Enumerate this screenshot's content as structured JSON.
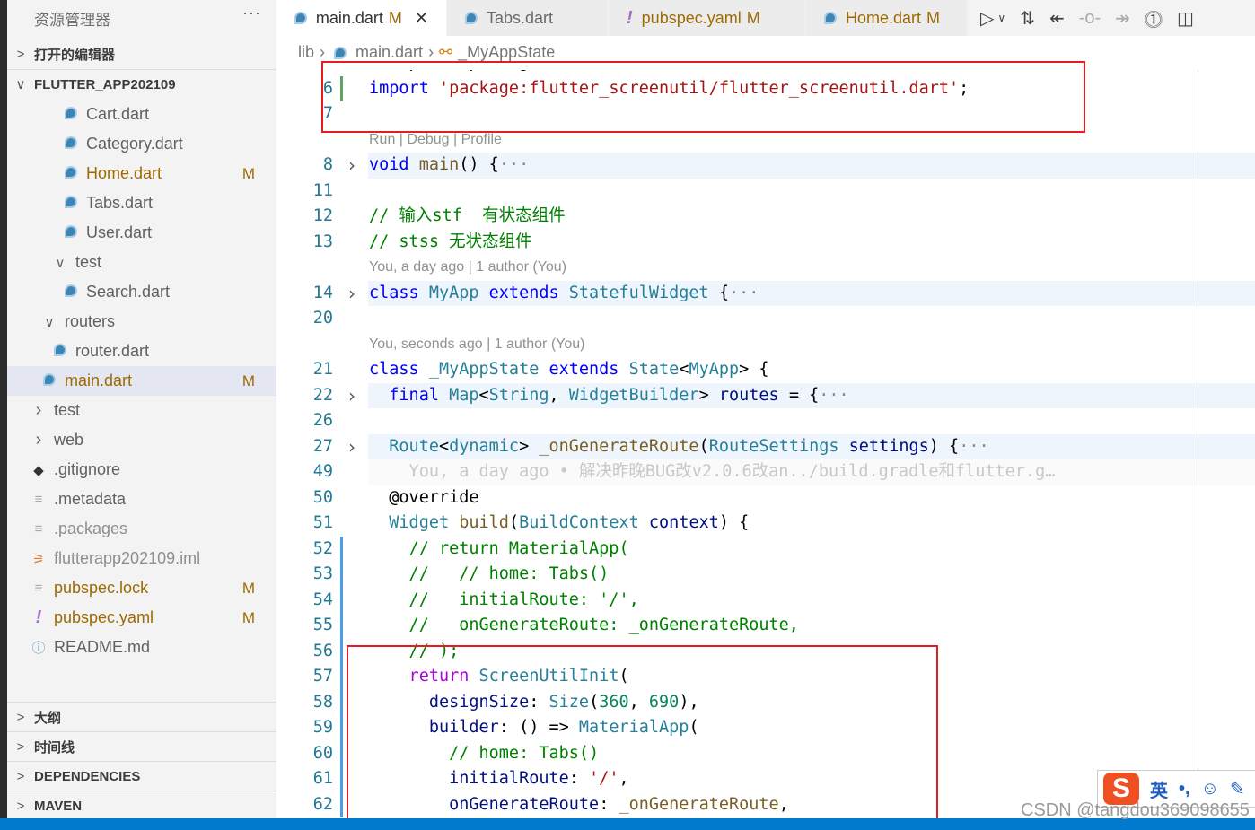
{
  "sidebar": {
    "title": "资源管理器",
    "more": "···",
    "open_editors": "打开的编辑器",
    "project": "FLUTTER_APP202109",
    "items": [
      {
        "label": "Cart.dart",
        "icon": "dart-icon",
        "indent": 60
      },
      {
        "label": "Category.dart",
        "icon": "dart-icon",
        "indent": 60
      },
      {
        "label": "Home.dart",
        "icon": "dart-icon",
        "indent": 60,
        "badge": "M"
      },
      {
        "label": "Tabs.dart",
        "icon": "dart-icon",
        "indent": 60
      },
      {
        "label": "User.dart",
        "icon": "dart-icon",
        "indent": 60
      },
      {
        "label": "test",
        "icon": "chevron-down-icon",
        "indent": 48
      },
      {
        "label": "Search.dart",
        "icon": "dart-icon",
        "indent": 60
      },
      {
        "label": "routers",
        "icon": "chevron-down-icon",
        "indent": 36
      },
      {
        "label": "router.dart",
        "icon": "dart-icon",
        "indent": 48
      },
      {
        "label": "main.dart",
        "icon": "dart-icon",
        "indent": 36,
        "badge": "M",
        "selected": true
      },
      {
        "label": "test",
        "icon": "chevron-right-icon",
        "indent": 24
      },
      {
        "label": "web",
        "icon": "chevron-right-icon",
        "indent": 24
      },
      {
        "label": ".gitignore",
        "icon": "git-icon",
        "indent": 24
      },
      {
        "label": ".metadata",
        "icon": "file-lines-icon",
        "indent": 24
      },
      {
        "label": ".packages",
        "icon": "file-lines-icon",
        "indent": 24,
        "dim": true
      },
      {
        "label": "flutterapp202109.iml",
        "icon": "rss-icon",
        "indent": 24,
        "dim": true
      },
      {
        "label": "pubspec.lock",
        "icon": "file-lines-icon",
        "indent": 24,
        "badge": "M"
      },
      {
        "label": "pubspec.yaml",
        "icon": "exclamation-icon",
        "indent": 24,
        "badge": "M"
      },
      {
        "label": "README.md",
        "icon": "info-icon",
        "indent": 24
      }
    ],
    "panels": [
      "大纲",
      "时间线",
      "DEPENDENCIES",
      "MAVEN"
    ]
  },
  "tabs": [
    {
      "label": "main.dart",
      "badge": "M",
      "active": true,
      "icon": "dart-icon"
    },
    {
      "label": "Tabs.dart",
      "icon": "dart-icon"
    },
    {
      "label": "pubspec.yaml",
      "badge": "M",
      "icon": "exclamation-icon"
    },
    {
      "label": "Home.dart",
      "badge": "M",
      "icon": "dart-icon"
    }
  ],
  "breadcrumb": [
    "lib",
    "main.dart",
    "_MyAppState"
  ],
  "code": [
    {
      "ln": "",
      "seg": [
        [
          "  import 'package:.../...';",
          "p"
        ]
      ]
    },
    {
      "ln": "6",
      "gutter": "#5ca463",
      "seg": [
        [
          "import ",
          "k"
        ],
        [
          "'package:flutter_screenutil/flutter_screenutil.dart'",
          "s"
        ],
        [
          ";",
          "p"
        ]
      ]
    },
    {
      "ln": "7",
      "seg": []
    },
    {
      "lens": "Run | Debug | Profile"
    },
    {
      "ln": "8",
      "fold": true,
      "hl": true,
      "seg": [
        [
          "void ",
          "k"
        ],
        [
          "main",
          "f"
        ],
        [
          "() {",
          "p"
        ],
        [
          "···",
          "dot"
        ]
      ]
    },
    {
      "ln": "11",
      "seg": []
    },
    {
      "ln": "12",
      "seg": [
        [
          "// 输入stf  有状态组件",
          "c"
        ]
      ]
    },
    {
      "ln": "13",
      "seg": [
        [
          "// stss 无状态组件",
          "c"
        ]
      ]
    },
    {
      "lens": "You, a day ago | 1 author (You)"
    },
    {
      "ln": "14",
      "fold": true,
      "hl": true,
      "seg": [
        [
          "class ",
          "k"
        ],
        [
          "MyApp ",
          "t"
        ],
        [
          "extends ",
          "k"
        ],
        [
          "StatefulWidget ",
          "t"
        ],
        [
          "{",
          "p"
        ],
        [
          "···",
          "dot"
        ]
      ]
    },
    {
      "ln": "20",
      "seg": []
    },
    {
      "lens": "You, seconds ago | 1 author (You)"
    },
    {
      "ln": "21",
      "seg": [
        [
          "class ",
          "k"
        ],
        [
          "_MyAppState ",
          "t"
        ],
        [
          "extends ",
          "k"
        ],
        [
          "State",
          "t"
        ],
        [
          "<",
          "p"
        ],
        [
          "MyApp",
          "t"
        ],
        [
          "> {",
          "p"
        ]
      ]
    },
    {
      "ln": "22",
      "fold": true,
      "hl": true,
      "seg": [
        [
          "  final ",
          "k"
        ],
        [
          "Map",
          "t"
        ],
        [
          "<",
          "p"
        ],
        [
          "String",
          "t"
        ],
        [
          ", ",
          "p"
        ],
        [
          "WidgetBuilder",
          "t"
        ],
        [
          "> ",
          "p"
        ],
        [
          "routes",
          "v"
        ],
        [
          " = {",
          "p"
        ],
        [
          "···",
          "dot"
        ]
      ]
    },
    {
      "ln": "26",
      "seg": []
    },
    {
      "ln": "27",
      "fold": true,
      "hl": true,
      "seg": [
        [
          "  Route",
          "t"
        ],
        [
          "<",
          "p"
        ],
        [
          "dynamic",
          "t"
        ],
        [
          "> ",
          "p"
        ],
        [
          "_onGenerateRoute",
          "f"
        ],
        [
          "(",
          "p"
        ],
        [
          "RouteSettings ",
          "t"
        ],
        [
          "settings",
          "v"
        ],
        [
          ") {",
          "p"
        ],
        [
          "···",
          "dot"
        ]
      ]
    },
    {
      "ln": "49",
      "blame": true,
      "seg": [
        [
          "    You, a day ago • 解决昨晚BUG改v2.0.6改an../build.gradle和flutter.g…",
          ""
        ]
      ]
    },
    {
      "ln": "50",
      "seg": [
        [
          "  @override",
          "p"
        ]
      ]
    },
    {
      "ln": "51",
      "seg": [
        [
          "  Widget ",
          "t"
        ],
        [
          "build",
          "f"
        ],
        [
          "(",
          "p"
        ],
        [
          "BuildContext ",
          "t"
        ],
        [
          "context",
          "v"
        ],
        [
          ") {",
          "p"
        ]
      ]
    },
    {
      "ln": "52",
      "gutter": "#4d9ee8",
      "seg": [
        [
          "    // return MaterialApp(",
          "c"
        ]
      ]
    },
    {
      "ln": "53",
      "gutter": "#4d9ee8",
      "seg": [
        [
          "    //   // home: Tabs()",
          "c"
        ]
      ]
    },
    {
      "ln": "54",
      "gutter": "#4d9ee8",
      "seg": [
        [
          "    //   initialRoute: '/',",
          "c"
        ]
      ]
    },
    {
      "ln": "55",
      "gutter": "#4d9ee8",
      "seg": [
        [
          "    //   onGenerateRoute: _onGenerateRoute,",
          "c"
        ]
      ]
    },
    {
      "ln": "56",
      "gutter": "#4d9ee8",
      "seg": [
        [
          "    // );",
          "c"
        ]
      ]
    },
    {
      "ln": "57",
      "gutter": "#4d9ee8",
      "seg": [
        [
          "    return ",
          "r"
        ],
        [
          "ScreenUtilInit",
          "t"
        ],
        [
          "(",
          "p"
        ]
      ]
    },
    {
      "ln": "58",
      "gutter": "#4d9ee8",
      "seg": [
        [
          "      designSize",
          "v"
        ],
        [
          ": ",
          "p"
        ],
        [
          "Size",
          "t"
        ],
        [
          "(",
          "p"
        ],
        [
          "360",
          "n"
        ],
        [
          ", ",
          "p"
        ],
        [
          "690",
          "n"
        ],
        [
          "),",
          "p"
        ]
      ]
    },
    {
      "ln": "59",
      "gutter": "#4d9ee8",
      "seg": [
        [
          "      builder",
          "v"
        ],
        [
          ": () => ",
          "p"
        ],
        [
          "MaterialApp",
          "t"
        ],
        [
          "(",
          "p"
        ]
      ]
    },
    {
      "ln": "60",
      "gutter": "#4d9ee8",
      "seg": [
        [
          "        // home: Tabs()",
          "c"
        ]
      ]
    },
    {
      "ln": "61",
      "gutter": "#4d9ee8",
      "seg": [
        [
          "        initialRoute",
          "v"
        ],
        [
          ": ",
          "p"
        ],
        [
          "'/'",
          "s"
        ],
        [
          ",",
          "p"
        ]
      ]
    },
    {
      "ln": "62",
      "gutter": "#4d9ee8",
      "seg": [
        [
          "        onGenerateRoute",
          "v"
        ],
        [
          ": ",
          "p"
        ],
        [
          "_onGenerateRoute",
          "f"
        ],
        [
          ",",
          "p"
        ]
      ]
    }
  ],
  "ime": {
    "lang": "英",
    "punct": "•,"
  },
  "watermark": "CSDN @tangdou369098655",
  "colors": {
    "accent": "#007acc",
    "modified": "#9e6a03",
    "annotation": "#e51c23"
  }
}
